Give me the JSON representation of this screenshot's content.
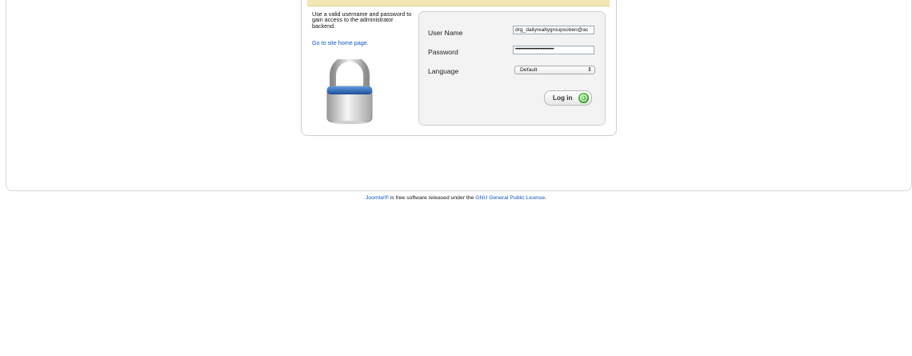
{
  "login": {
    "help_text": "Use a valid username and password to gain access to the administrator backend.",
    "home_link": "Go to site home page.",
    "username_label": "User Name",
    "username_value": "drg_dailyrealtygroupsoben@ac",
    "password_label": "Password",
    "password_value": "••••••••••••••••••••••••••••••••",
    "language_label": "Language",
    "language_selected": "Default",
    "login_button": "Log in"
  },
  "footer": {
    "joomla_link": "Joomla!®",
    "middle_text": " is free software released under the ",
    "license_link": "GNU General Public License",
    "end": "."
  },
  "colors": {
    "link": "#0b55c4",
    "strip": "#f3e7b3",
    "go_button": "#2f9b1f"
  },
  "icons": {
    "lock": "padlock-icon",
    "go": "arrow-right-circle-icon",
    "select": "double-chevron-icon"
  }
}
